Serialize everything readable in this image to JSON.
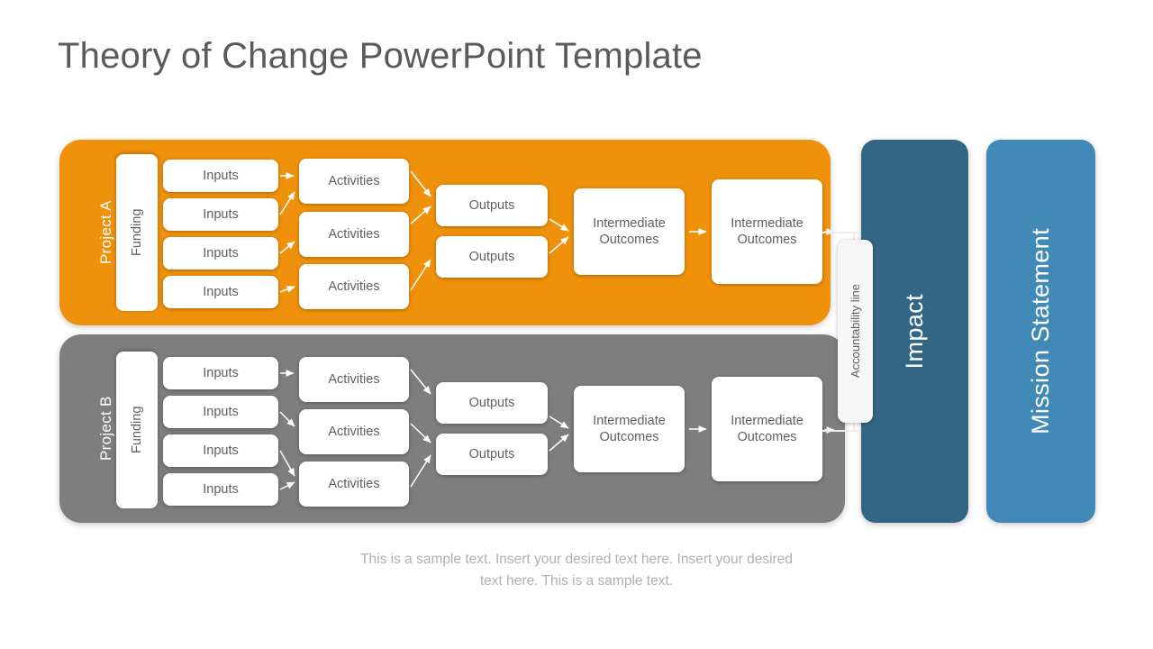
{
  "slide": {
    "title": "Theory of Change PowerPoint Template",
    "caption": "This is a sample text. Insert your desired text here. Insert your desired text here. This is a sample text.",
    "background_color": "#FFFFFF",
    "title_color": "#5A5A5A"
  },
  "projects": [
    {
      "id": "project-a",
      "label": "Project A",
      "color": "#F0910B",
      "funding": {
        "label": "Funding"
      },
      "inputs": [
        {
          "label": "Inputs"
        },
        {
          "label": "Inputs"
        },
        {
          "label": "Inputs"
        },
        {
          "label": "Inputs"
        }
      ],
      "activities": [
        {
          "label": "Activities"
        },
        {
          "label": "Activities"
        },
        {
          "label": "Activities"
        }
      ],
      "outputs": [
        {
          "label": "Outputs"
        },
        {
          "label": "Outputs"
        }
      ],
      "outcomes": [
        {
          "label": "Intermediate Outcomes"
        },
        {
          "label": "Intermediate Outcomes"
        }
      ]
    },
    {
      "id": "project-b",
      "label": "Project B",
      "color": "#7E7E7E",
      "funding": {
        "label": "Funding"
      },
      "inputs": [
        {
          "label": "Inputs"
        },
        {
          "label": "Inputs"
        },
        {
          "label": "Inputs"
        },
        {
          "label": "Inputs"
        }
      ],
      "activities": [
        {
          "label": "Activities"
        },
        {
          "label": "Activities"
        },
        {
          "label": "Activities"
        }
      ],
      "outputs": [
        {
          "label": "Outputs"
        },
        {
          "label": "Outputs"
        }
      ],
      "outcomes": [
        {
          "label": "Intermediate Outcomes"
        },
        {
          "label": "Intermediate Outcomes"
        }
      ]
    }
  ],
  "accountability": {
    "label": "Accountability line",
    "color": "#F7F7F7"
  },
  "panels": [
    {
      "id": "impact",
      "label": "Impact",
      "color": "#336684"
    },
    {
      "id": "mission",
      "label": "Mission Statement",
      "color": "#4189B7"
    }
  ]
}
